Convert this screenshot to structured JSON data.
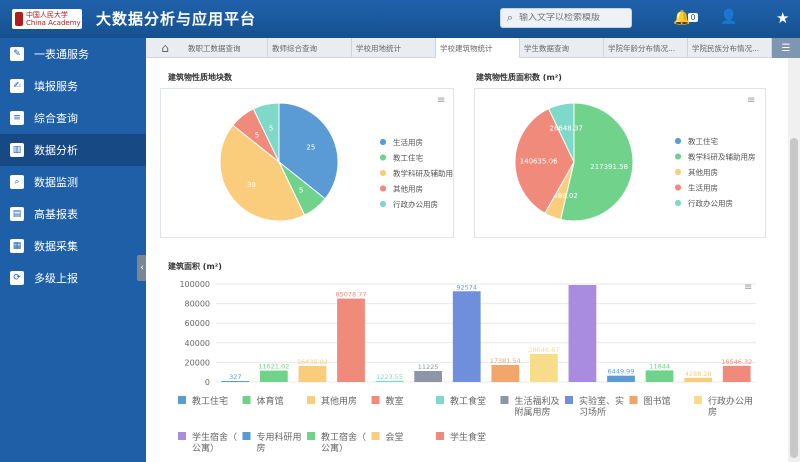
{
  "app": {
    "logo_text": "中国人民大学 China Academy",
    "title": "大数据分析与应用平台"
  },
  "search": {
    "placeholder": "输入文字以检索模版"
  },
  "header": {
    "notification_count": "0"
  },
  "sidebar": {
    "items": [
      {
        "label": "一表通服务",
        "icon": "pencil-icon"
      },
      {
        "label": "填报服务",
        "icon": "edit-icon"
      },
      {
        "label": "综合查询",
        "icon": "list-icon"
      },
      {
        "label": "数据分析",
        "icon": "chart-icon"
      },
      {
        "label": "数据监测",
        "icon": "search-icon"
      },
      {
        "label": "高基报表",
        "icon": "report-icon"
      },
      {
        "label": "数据采集",
        "icon": "form-icon"
      },
      {
        "label": "多级上报",
        "icon": "share-icon"
      }
    ]
  },
  "tabs": [
    "教职工数据查询",
    "教师综合查询",
    "学校用地统计",
    "学校建筑物统计",
    "学生数据查询",
    "学院年龄分布情况...",
    "学院民族分布情况..."
  ],
  "chart_data": [
    {
      "type": "pie",
      "title": "建筑物性质地块数",
      "slices": [
        {
          "label": "生活用房",
          "value": 25,
          "color": "#5b9bd5"
        },
        {
          "label": "教工住宅",
          "value": 5,
          "color": "#71d38b"
        },
        {
          "label": "教学科研及辅助用房",
          "value": 30,
          "color": "#f9cd7b"
        },
        {
          "label": "其他用房",
          "value": 5,
          "color": "#f08a7b"
        },
        {
          "label": "行政办公用房",
          "value": 5,
          "color": "#7ed9c8"
        }
      ]
    },
    {
      "type": "pie",
      "title": "建筑物性质面积数 (m²)",
      "slices": [
        {
          "label": "教工住宅",
          "value": 217391.58,
          "color": "#71d38b"
        },
        {
          "label": "教学科研及辅助用房",
          "value": 18488.02,
          "color": "#f9cd7b"
        },
        {
          "label": "其他用房",
          "value": 0,
          "color": "#f08a7b"
        },
        {
          "label": "生活用房",
          "value": 140635.06,
          "color": "#f08a7b"
        },
        {
          "label": "行政办公用房",
          "value": 28648.37,
          "color": "#7ed9c8"
        }
      ],
      "legend": [
        {
          "label": "教工住宅",
          "color": "#5b9bd5"
        },
        {
          "label": "教学科研及辅助用房",
          "color": "#71d38b"
        },
        {
          "label": "其他用房",
          "color": "#f9cd7b"
        },
        {
          "label": "生活用房",
          "color": "#f08a7b"
        },
        {
          "label": "行政办公用房",
          "color": "#7ed9c8"
        }
      ]
    },
    {
      "type": "bar",
      "title": "建筑面积 (m²)",
      "ylim": [
        0,
        100000
      ],
      "yticks": [
        "100000",
        "80000",
        "60000",
        "40000",
        "20000",
        "0"
      ],
      "bars": [
        {
          "label": "教工住宅",
          "value": 327,
          "value_label": "327",
          "color": "#5b9bd5"
        },
        {
          "label": "体育馆",
          "value": 11621.02,
          "value_label": "11621.02",
          "color": "#71d38b"
        },
        {
          "label": "其他用房",
          "value": 16435.02,
          "value_label": "16435.02",
          "color": "#f9cd7b"
        },
        {
          "label": "教室",
          "value": 85078.77,
          "value_label": "85078.77",
          "color": "#f08a7b"
        },
        {
          "label": "教工食堂",
          "value": 1223.55,
          "value_label": "1223.55",
          "color": "#7ed9c8"
        },
        {
          "label": "生活福利及附属用房",
          "value": 11225,
          "value_label": "11225",
          "color": "#8c96a6"
        },
        {
          "label": "实验室、实习场所",
          "value": 92574,
          "value_label": "92574",
          "color": "#6f8fdc"
        },
        {
          "label": "图书馆",
          "value": 17381.54,
          "value_label": "17381.54",
          "color": "#f2a66b"
        },
        {
          "label": "行政办公用房",
          "value": 28646.67,
          "value_label": "28646.67",
          "color": "#f7dc8a"
        },
        {
          "label": "学生宿舍（公寓）",
          "value": 99000,
          "value_label": "",
          "color": "#a98be0"
        },
        {
          "label": "专用科研用房",
          "value": 6449.99,
          "value_label": "6449.99",
          "color": "#5b9bd5"
        },
        {
          "label": "教工宿舍（公寓）",
          "value": 11844,
          "value_label": "11844",
          "color": "#71d38b"
        },
        {
          "label": "会堂",
          "value": 4288.26,
          "value_label": "4288.26",
          "color": "#f9cd7b"
        },
        {
          "label": "学生食堂",
          "value": 16546.32,
          "value_label": "16546.32",
          "color": "#f08a7b"
        }
      ]
    }
  ]
}
